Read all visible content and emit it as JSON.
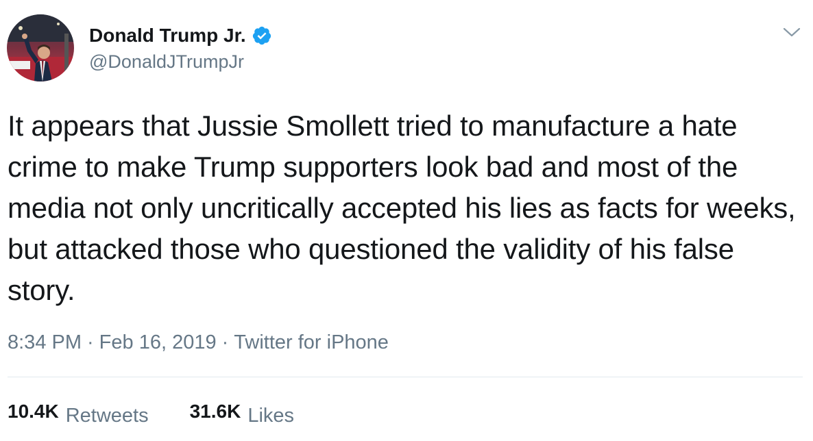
{
  "author": {
    "display_name": "Donald Trump Jr.",
    "handle": "@DonaldJTrumpJr",
    "verified": true,
    "verified_color": "#1da1f2"
  },
  "menu": {
    "icon": "chevron-down-icon"
  },
  "tweet": {
    "text": "It appears that Jussie Smollett tried to manufacture a hate crime to make Trump supporters look bad and most of the media not only uncritically accepted his lies as facts for weeks, but attacked those who questioned the validity of his false story."
  },
  "meta": {
    "time": "8:34 PM",
    "separator": "·",
    "date": "Feb 16, 2019",
    "source": "Twitter for iPhone"
  },
  "stats": {
    "retweets_count": "10.4K",
    "retweets_label": "Retweets",
    "likes_count": "31.6K",
    "likes_label": "Likes"
  },
  "colors": {
    "text_primary": "#14171a",
    "text_secondary": "#657786",
    "divider": "#e1e8ed"
  }
}
